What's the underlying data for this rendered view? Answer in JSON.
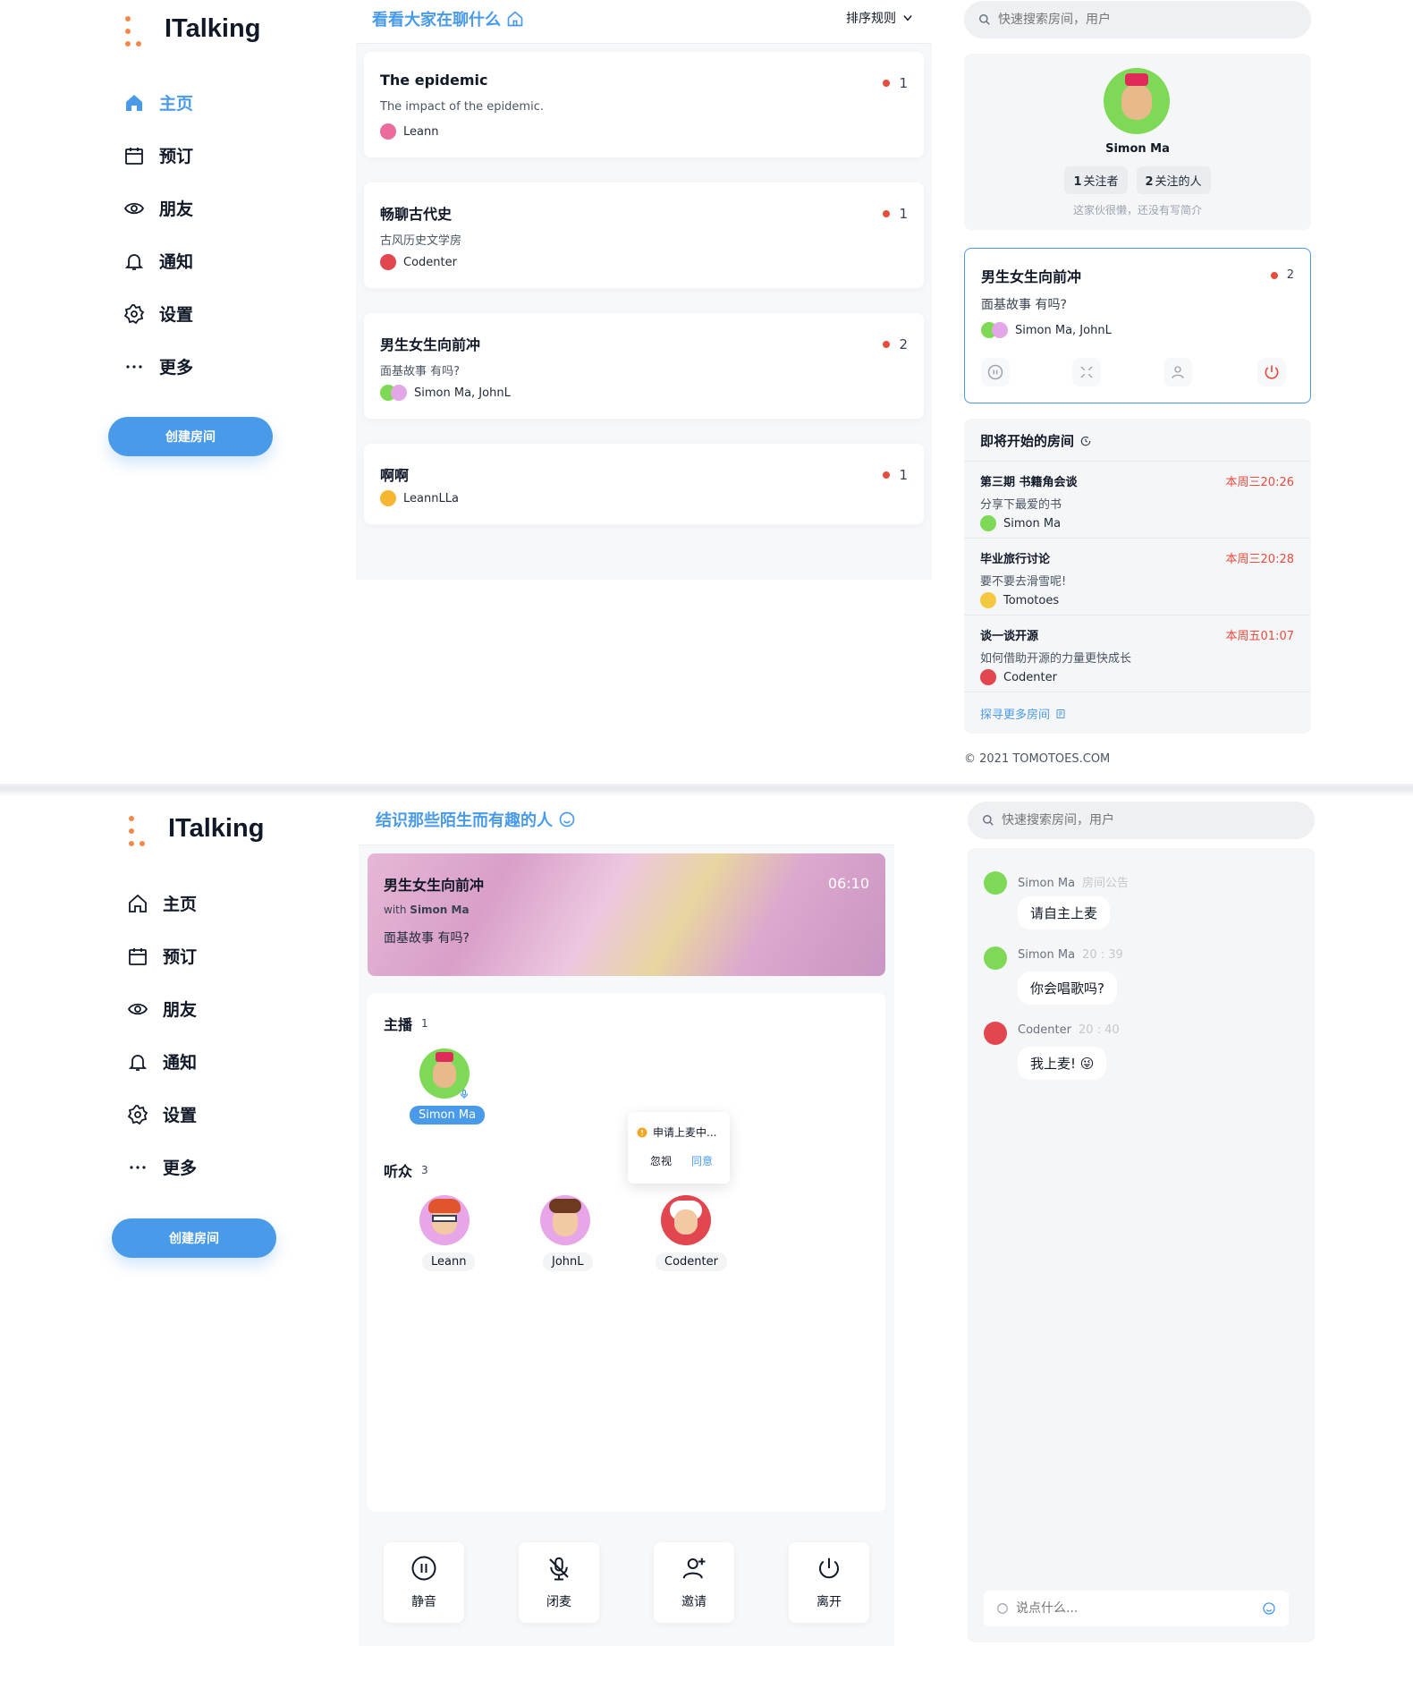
{
  "app": {
    "name": "ITalking"
  },
  "nav": {
    "items": [
      {
        "label": "主页",
        "icon": "home-icon"
      },
      {
        "label": "预订",
        "icon": "calendar-icon"
      },
      {
        "label": "朋友",
        "icon": "eye-icon"
      },
      {
        "label": "通知",
        "icon": "bell-icon"
      },
      {
        "label": "设置",
        "icon": "gear-icon"
      },
      {
        "label": "更多",
        "icon": "more-icon"
      }
    ],
    "create_label": "创建房间"
  },
  "home": {
    "title": "看看大家在聊什么",
    "sort_label": "排序规则",
    "rooms": [
      {
        "title": "The epidemic",
        "desc": "The impact of the epidemic.",
        "users": "Leann",
        "count": "1"
      },
      {
        "title": "畅聊古代史",
        "desc": "古风历史文学房",
        "users": "Codenter",
        "count": "1"
      },
      {
        "title": "男生女生向前冲",
        "desc": "面基故事 有吗?",
        "users": "Simon Ma, JohnL",
        "count": "2"
      },
      {
        "title": "啊啊",
        "desc": "",
        "users": "LeannLLa",
        "count": "1"
      }
    ]
  },
  "search": {
    "placeholder": "快速搜索房间，用户"
  },
  "profile": {
    "name": "Simon Ma",
    "followers": "1",
    "followers_label": "关注者",
    "following": "2",
    "following_label": "关注的人",
    "bio": "这家伙很懒，还没有写简介"
  },
  "current_room": {
    "title": "男生女生向前冲",
    "desc": "面基故事 有吗?",
    "users": "Simon Ma, JohnL",
    "count": "2"
  },
  "upcoming": {
    "title": "即将开始的房间",
    "items": [
      {
        "title": "第三期 书籍角会谈",
        "time": "本周三20:26",
        "desc": "分享下最爱的书",
        "user": "Simon Ma"
      },
      {
        "title": "毕业旅行讨论",
        "time": "本周三20:28",
        "desc": "要不要去滑雪呢!",
        "user": "Tomotoes"
      },
      {
        "title": "谈一谈开源",
        "time": "本周五01:07",
        "desc": "如何借助开源的力量更快成长",
        "user": "Codenter"
      }
    ],
    "more_label": "探寻更多房间"
  },
  "footer": {
    "copyright": "© 2021 TOMOTOES.COM"
  },
  "room": {
    "section_title": "结识那些陌生而有趣的人",
    "banner_title": "男生女生向前冲",
    "with_label": "with",
    "host_name": "Simon Ma",
    "banner_desc": "面基故事 有吗?",
    "timer": "06:10",
    "hosts_label": "主播",
    "hosts_count": "1",
    "hosts": [
      "Simon Ma"
    ],
    "audience_label": "听众",
    "audience_count": "3",
    "audience": [
      "Leann",
      "JohnL",
      "Codenter"
    ],
    "popover": {
      "text": "申请上麦中...",
      "ignore": "忽视",
      "agree": "同意"
    },
    "controls": [
      "静音",
      "闭麦",
      "邀请",
      "离开"
    ]
  },
  "chat": {
    "messages": [
      {
        "name": "Simon Ma",
        "meta": "房间公告",
        "text": "请自主上麦"
      },
      {
        "name": "Simon Ma",
        "meta": "20 : 39",
        "text": "你会唱歌吗?"
      },
      {
        "name": "Codenter",
        "meta": "20 : 40",
        "text": "我上麦! 😜"
      }
    ],
    "input_placeholder": "说点什么..."
  },
  "colors": {
    "accent": "#4a9aea",
    "live_dot": "#e74c3c",
    "logo": "#f08a4b",
    "time_red": "#e74c3c"
  }
}
